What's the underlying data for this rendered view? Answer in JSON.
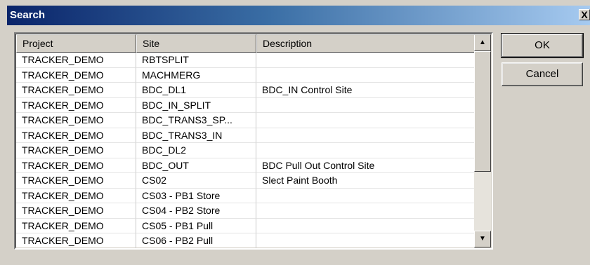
{
  "window": {
    "title": "Search",
    "close_label": "X"
  },
  "list": {
    "columns": [
      "Project",
      "Site",
      "Description"
    ],
    "rows": [
      [
        "TRACKER_DEMO",
        "RBTSPLIT",
        ""
      ],
      [
        "TRACKER_DEMO",
        "MACHMERG",
        ""
      ],
      [
        "TRACKER_DEMO",
        "BDC_DL1",
        "BDC_IN Control Site"
      ],
      [
        "TRACKER_DEMO",
        "BDC_IN_SPLIT",
        ""
      ],
      [
        "TRACKER_DEMO",
        "BDC_TRANS3_SP...",
        ""
      ],
      [
        "TRACKER_DEMO",
        "BDC_TRANS3_IN",
        ""
      ],
      [
        "TRACKER_DEMO",
        "BDC_DL2",
        ""
      ],
      [
        "TRACKER_DEMO",
        "BDC_OUT",
        "BDC Pull Out Control Site"
      ],
      [
        "TRACKER_DEMO",
        "CS02",
        "Slect Paint Booth"
      ],
      [
        "TRACKER_DEMO",
        "CS03 - PB1 Store",
        ""
      ],
      [
        "TRACKER_DEMO",
        "CS04 - PB2 Store",
        ""
      ],
      [
        "TRACKER_DEMO",
        "CS05 - PB1 Pull",
        ""
      ],
      [
        "TRACKER_DEMO",
        "CS06 - PB2 Pull",
        ""
      ]
    ],
    "scroll_up_icon": "▲",
    "scroll_down_icon": "▼"
  },
  "buttons": {
    "ok_label": "OK",
    "cancel_label": "Cancel"
  }
}
